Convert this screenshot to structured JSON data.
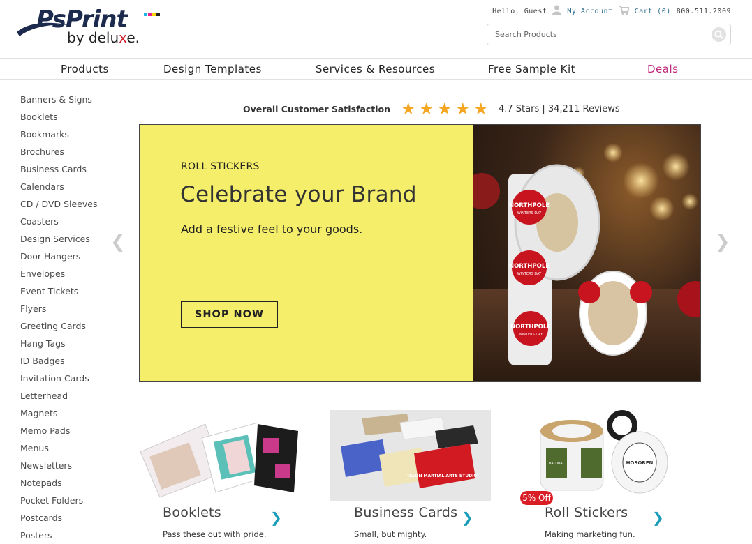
{
  "brand": {
    "logo_text": "PsPrint",
    "byline_prefix": "by delu",
    "byline_x": "x",
    "byline_suffix": "e.",
    "colors": {
      "cyan": "#1fb5e6",
      "magenta": "#e6228c",
      "yellow": "#ffd400",
      "black": "#222222"
    }
  },
  "utility": {
    "greeting": "Hello, Guest",
    "account_icon": "user-icon",
    "account_label": "My Account",
    "cart_icon": "cart-icon",
    "cart_label": "Cart (0)",
    "phone": "800.511.2009"
  },
  "search": {
    "placeholder": "Search Products",
    "icon": "search-icon"
  },
  "nav": {
    "items": [
      {
        "label": "Products"
      },
      {
        "label": "Design Templates"
      },
      {
        "label": "Services & Resources"
      },
      {
        "label": "Free Sample Kit"
      },
      {
        "label": "Deals",
        "color": "#c0287a"
      }
    ]
  },
  "sidebar": {
    "items": [
      "Banners & Signs",
      "Booklets",
      "Bookmarks",
      "Brochures",
      "Business Cards",
      "Calendars",
      "CD / DVD Sleeves",
      "Coasters",
      "Design Services",
      "Door Hangers",
      "Envelopes",
      "Event Tickets",
      "Flyers",
      "Greeting Cards",
      "Hang Tags",
      "ID Badges",
      "Invitation Cards",
      "Letterhead",
      "Magnets",
      "Memo Pads",
      "Menus",
      "Newsletters",
      "Notepads",
      "Pocket Folders",
      "Postcards",
      "Posters"
    ]
  },
  "rating": {
    "label": "Overall Customer Satisfaction",
    "stars_value": 4.7,
    "stars_max": 5,
    "summary": "4.7 Stars | 34,211 Reviews"
  },
  "hero": {
    "eyebrow": "ROLL STICKERS",
    "headline": "Celebrate your Brand",
    "subtext": "Add a festive feel to your goods.",
    "cta": "SHOP NOW",
    "bg_color": "#f5ee6a",
    "sticker_text": "NORTHPOLE",
    "sticker_subtext": "WINTERS DAY",
    "prev_icon": "chevron-left-icon",
    "next_icon": "chevron-right-icon"
  },
  "products": [
    {
      "name": "Booklets",
      "tagline": "Pass these out with pride.",
      "icon": "chevron-right-icon"
    },
    {
      "name": "Business Cards",
      "tagline": "Small, but mighty.",
      "icon": "chevron-right-icon"
    },
    {
      "name": "Roll Stickers",
      "tagline": "Making marketing fun.",
      "icon": "chevron-right-icon",
      "badge": "5% Off"
    }
  ],
  "card_text": {
    "talon": "TALON MARTIAL ARTS STUDIO",
    "natural": "NATURAL",
    "hosoren": "HOSOREN"
  }
}
